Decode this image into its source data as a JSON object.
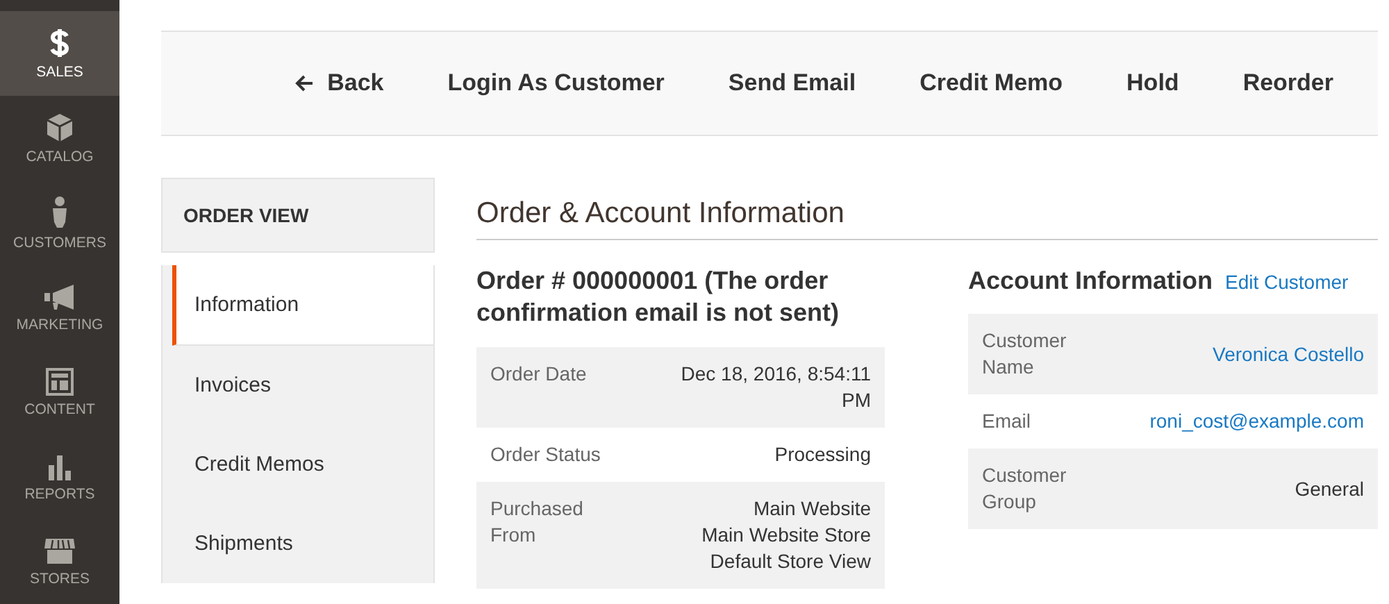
{
  "sidebar": {
    "items": [
      {
        "label": "SALES",
        "kind": "dollar",
        "selected": true
      },
      {
        "label": "CATALOG",
        "kind": "box",
        "selected": false
      },
      {
        "label": "CUSTOMERS",
        "kind": "person",
        "selected": false
      },
      {
        "label": "MARKETING",
        "kind": "megaphone",
        "selected": false
      },
      {
        "label": "CONTENT",
        "kind": "layout",
        "selected": false
      },
      {
        "label": "REPORTS",
        "kind": "bars",
        "selected": false
      },
      {
        "label": "STORES",
        "kind": "store",
        "selected": false
      }
    ]
  },
  "toolbar": {
    "buttons": [
      {
        "label": "Back",
        "kind": "back"
      },
      {
        "label": "Login As Customer",
        "kind": "action"
      },
      {
        "label": "Send Email",
        "kind": "action"
      },
      {
        "label": "Credit Memo",
        "kind": "action"
      },
      {
        "label": "Hold",
        "kind": "action"
      },
      {
        "label": "Reorder",
        "kind": "action"
      }
    ]
  },
  "order_view": {
    "title": "ORDER VIEW",
    "tabs": [
      {
        "label": "Information",
        "selected": true
      },
      {
        "label": "Invoices",
        "selected": false
      },
      {
        "label": "Credit Memos",
        "selected": false
      },
      {
        "label": "Shipments",
        "selected": false
      }
    ]
  },
  "section_title": "Order & Account Information",
  "order": {
    "title": "Order # 000000001 (The order confirmation email is not sent)",
    "rows": [
      {
        "label": "Order Date",
        "values": [
          "Dec 18, 2016, 8:54:11 PM"
        ]
      },
      {
        "label": "Order Status",
        "values": [
          "Processing"
        ]
      },
      {
        "label": "Purchased From",
        "values": [
          "Main Website",
          "Main Website Store",
          "Default Store View"
        ]
      }
    ]
  },
  "account": {
    "title": "Account Information",
    "edit_link": "Edit Customer",
    "rows": [
      {
        "label": "Customer Name",
        "value": "Veronica Costello",
        "kind": "link"
      },
      {
        "label": "Email",
        "value": "roni_cost@example.com",
        "kind": "link"
      },
      {
        "label": "Customer Group",
        "value": "General",
        "kind": "text"
      }
    ]
  }
}
